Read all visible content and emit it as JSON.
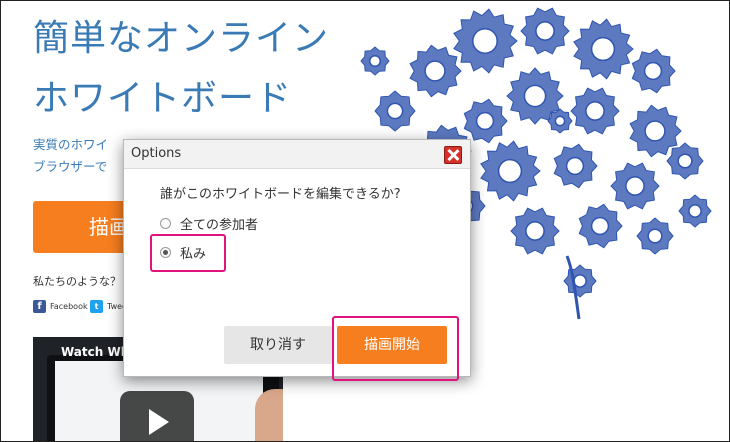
{
  "hero": {
    "title_line1": "簡単なオンライン",
    "title_line2": "ホワイトボード",
    "desc_line1": "実質のホワイ",
    "desc_line2": "ブラウザーで",
    "cta_label": "描画",
    "share_prompt": "私たちのような？",
    "facebook_label": "Facebook",
    "tweet_label": "Twee"
  },
  "video": {
    "title": "Watch Whi"
  },
  "dialog": {
    "title": "Options",
    "question": "誰がこのホワイトボードを編集できるか?",
    "options": [
      {
        "label": "全ての参加者",
        "checked": false
      },
      {
        "label": "私み",
        "checked": true
      }
    ],
    "cancel_label": "取り消す",
    "start_label": "描画開始"
  },
  "colors": {
    "accent_orange": "#f77e1f",
    "title_blue": "#3a7bb5",
    "highlight_pink": "#e0137d",
    "close_red": "#d4312b",
    "gear_blue": "#2f55b0"
  }
}
